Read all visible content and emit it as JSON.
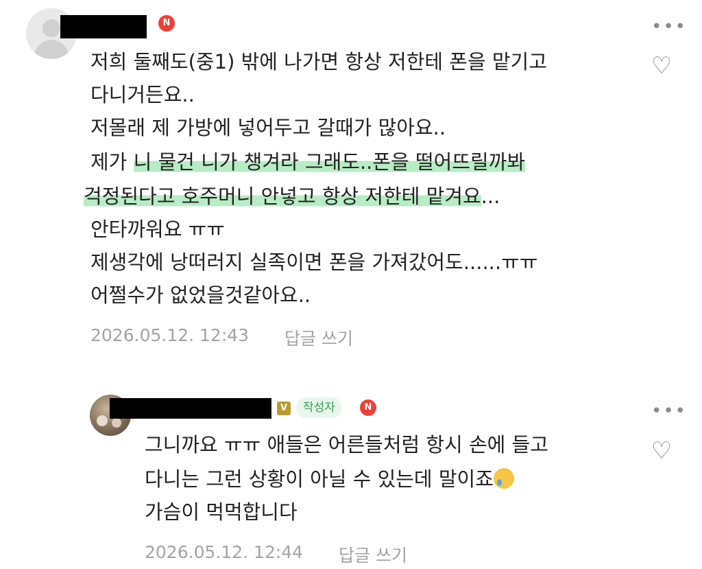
{
  "comments": [
    {
      "badge_n": "N",
      "more_label": "•••",
      "like_icon": "♡",
      "lines": [
        "저희 둘째도(중1) 밖에 나가면 항상 저한테 폰을 맡기고",
        "다니거든요..",
        "저몰래 제 가방에 넣어두고 갈때가 많아요..",
        "제가 ",
        "니 물건 니가 챙겨라 그래도..폰을 떨어뜨릴까봐",
        "걱정된다고 호주머니 안넣고 항상 저한테 맡겨요",
        "...",
        "안타까워요 ㅠㅠ",
        "제생각에 낭떠러지 실족이면 폰을 가져갔어도......ㅠㅠ",
        "어쩔수가 없었을것같아요.."
      ],
      "timestamp": "2026.05.12. 12:43",
      "reply_label": "답글 쓰기"
    },
    {
      "badge_v": "V",
      "author_tag": "작성자",
      "badge_n": "N",
      "more_label": "•••",
      "like_icon": "♡",
      "lines": [
        "그니까요 ㅠㅠ 애들은 어른들처럼 항시 손에 들고",
        "다니는 그런 상황이 아닐 수 있는데 말이죠",
        "가슴이 먹먹합니다"
      ],
      "emoji": "crying-face",
      "timestamp": "2026.05.12. 12:44",
      "reply_label": "답글 쓰기"
    }
  ],
  "colors": {
    "highlight": "#b8ecc4",
    "author_tag_bg": "#e8f7ec",
    "author_tag_text": "#2fa24f",
    "badge_n": "#ef3e36",
    "badge_v": "#b89b2a",
    "meta_text": "#a3a3a3"
  }
}
